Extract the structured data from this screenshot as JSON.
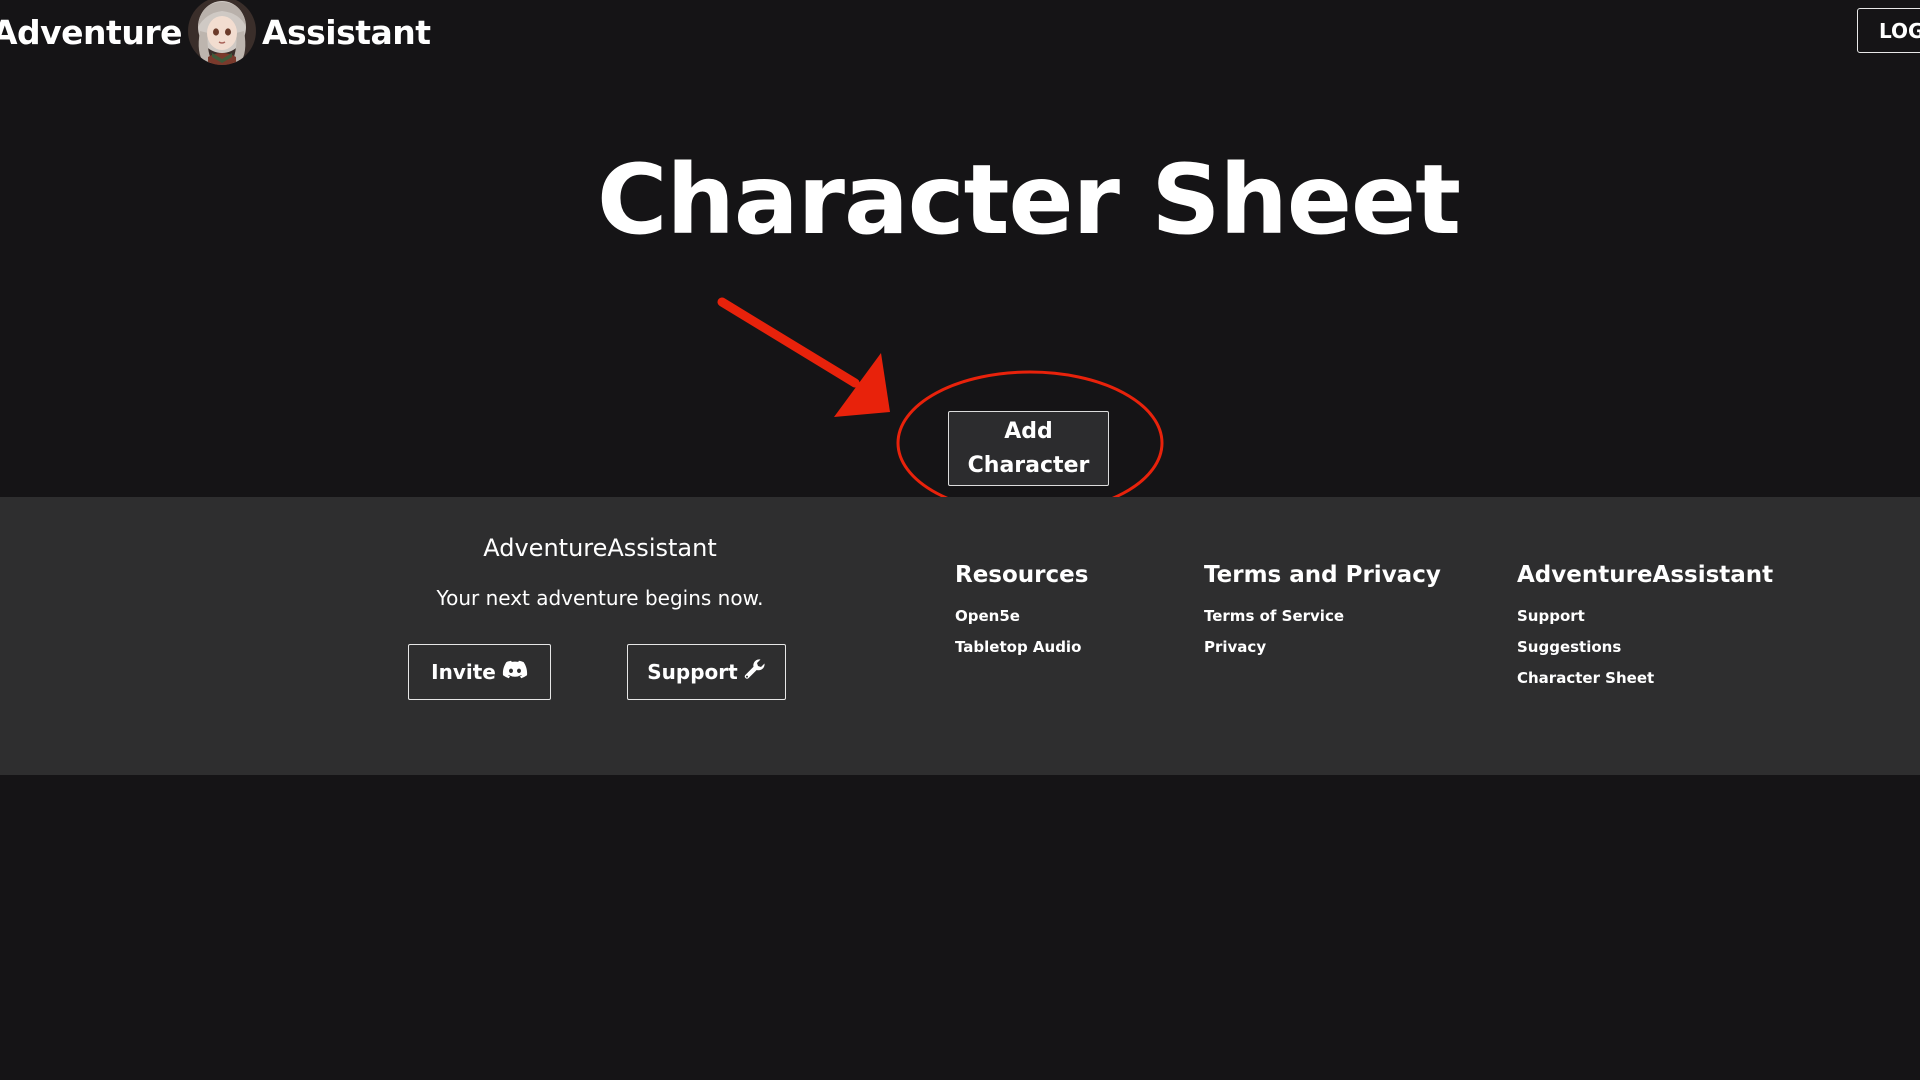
{
  "header": {
    "brand_part1": "Adventure",
    "brand_part2": "Assistant",
    "login_label": "LOGIN"
  },
  "main": {
    "title": "Character Sheet",
    "add_character_label": "Add Character"
  },
  "annotation": {
    "color": "#e8220b"
  },
  "footer": {
    "brand_title": "AdventureAssistant",
    "tagline": "Your next adventure begins now.",
    "invite_label": "Invite",
    "support_label": "Support",
    "columns": [
      {
        "heading": "Resources",
        "links": [
          "Open5e",
          "Tabletop Audio"
        ]
      },
      {
        "heading": "Terms and Privacy",
        "links": [
          "Terms of Service",
          "Privacy"
        ]
      },
      {
        "heading": "AdventureAssistant",
        "links": [
          "Support",
          "Suggestions",
          "Character Sheet"
        ]
      }
    ]
  },
  "icons": {
    "invite_icon": "discord-icon",
    "support_icon": "wrench-icon"
  },
  "colors": {
    "page_bg": "#151416",
    "footer_bg": "#2e2e2f",
    "button_bg": "#2c2c2e",
    "text": "#ffffff"
  }
}
